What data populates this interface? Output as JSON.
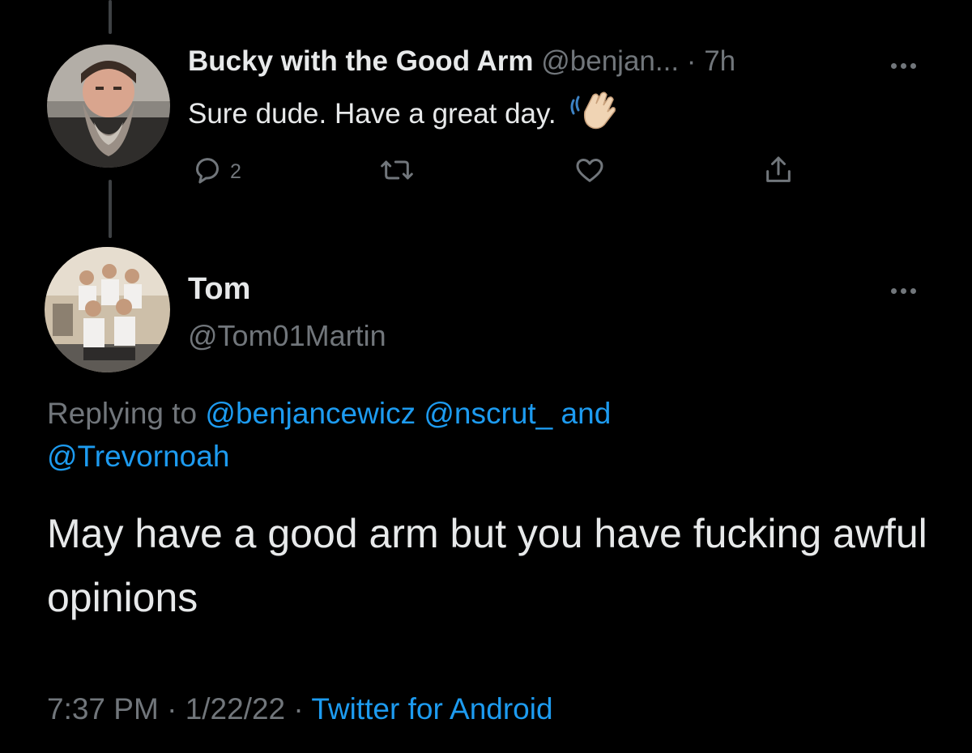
{
  "parent_tweet": {
    "display_name": "Bucky with the Good Arm",
    "handle": "@benjan...",
    "separator": "·",
    "time": "7h",
    "text": "Sure dude. Have a great day.",
    "emoji_icon": "waving-hand-icon",
    "reply_count": "2"
  },
  "reply_tweet": {
    "display_name": "Tom",
    "handle": "@Tom01Martin",
    "replying_prefix": "Replying to",
    "mentions": [
      "@benjancewicz",
      "@nscrut_"
    ],
    "and_word": "and",
    "last_mention": "@Trevornoah",
    "text": "May have a good arm but you have fucking awful opinions",
    "timestamp_time": "7:37 PM",
    "separator": "·",
    "timestamp_date": "1/22/22",
    "source": "Twitter for Android"
  },
  "colors": {
    "background": "#000000",
    "primary_text": "#e7e9ea",
    "secondary_text": "#71767b",
    "accent": "#1d9bf0",
    "thread_line": "#3e4144"
  }
}
